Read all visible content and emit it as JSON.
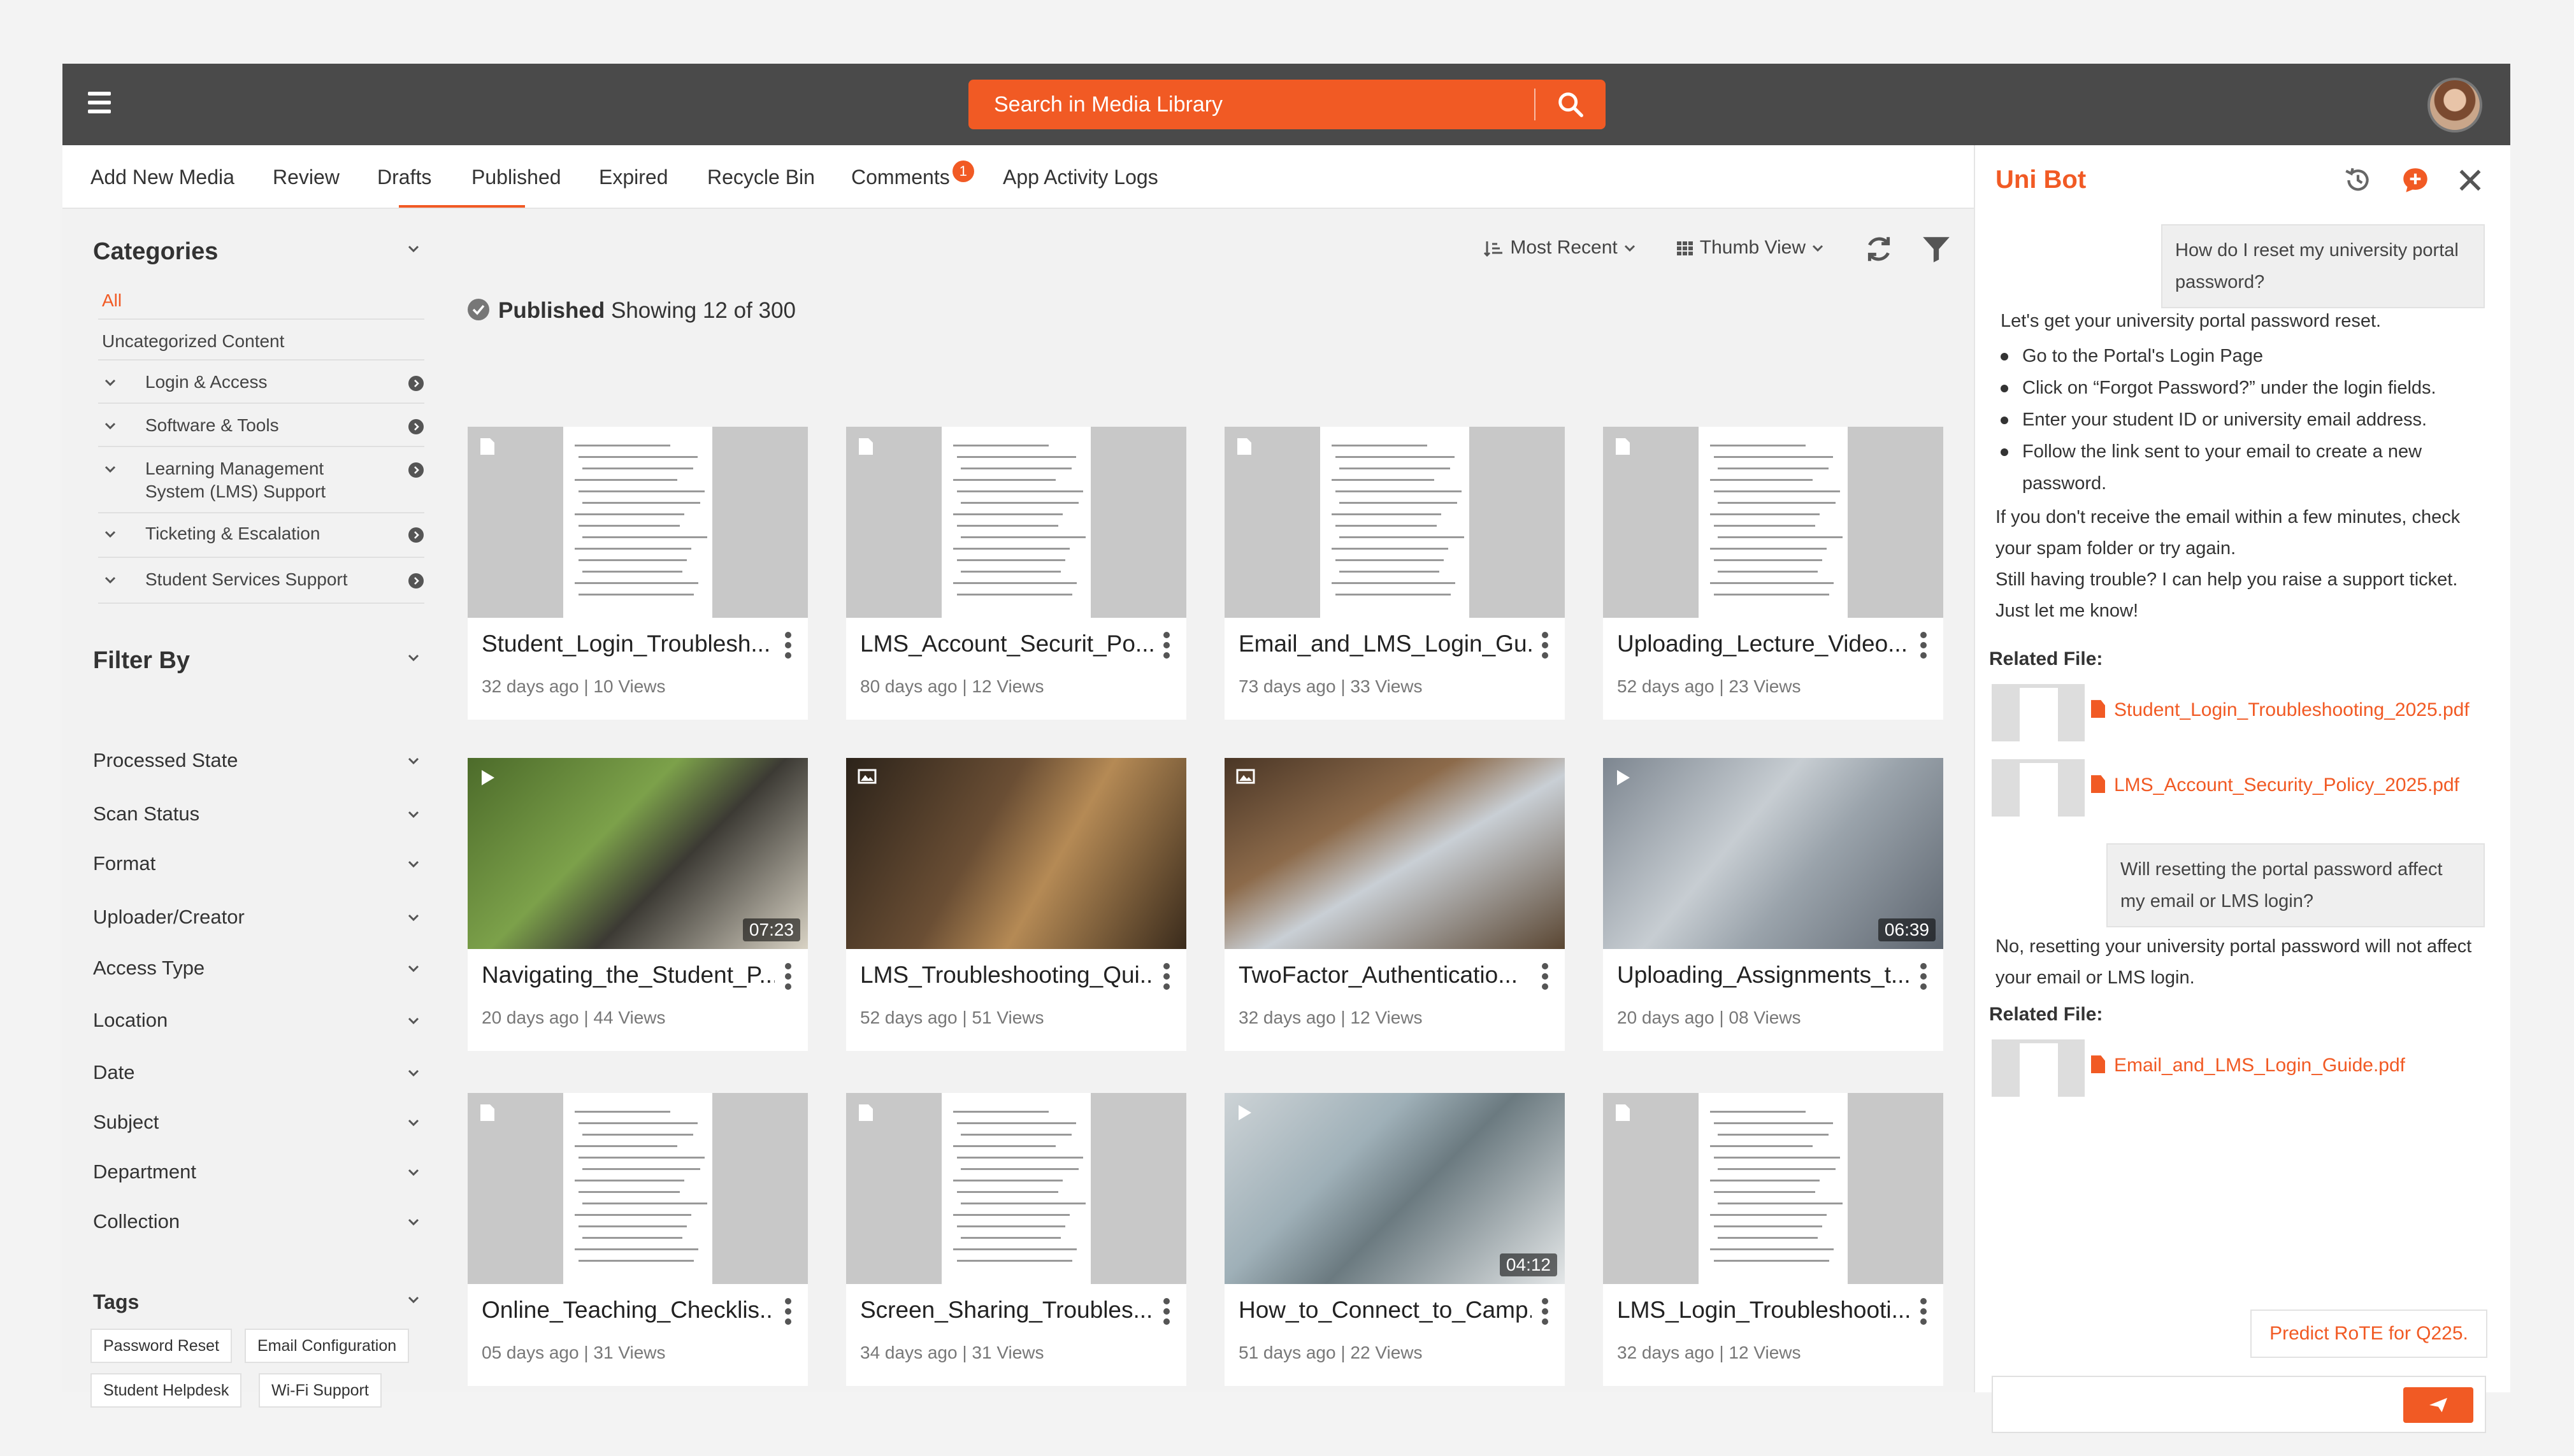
{
  "header": {
    "search_placeholder": "Search in Media Library"
  },
  "nav": {
    "items": [
      "Add New Media",
      "Review",
      "Drafts",
      "Published",
      "Expired",
      "Recycle Bin",
      "Comments",
      "App Activity Logs"
    ],
    "active": "Published",
    "comments_badge": "1"
  },
  "sidebar": {
    "categories_title": "Categories",
    "categories": [
      "All",
      "Uncategorized Content",
      "Login & Access",
      "Software & Tools",
      "Learning Management System (LMS) Support",
      "Ticketing & Escalation",
      "Student Services Support"
    ],
    "filter_title": "Filter By",
    "filters": [
      "Processed State",
      "Scan Status",
      "Format",
      "Uploader/Creator",
      "Access Type",
      "Location",
      "Date",
      "Subject",
      "Department",
      "Collection"
    ],
    "tags_title": "Tags",
    "tags": [
      "Password Reset",
      "Email Configuration",
      "Student Helpdesk",
      "Wi-Fi Support"
    ]
  },
  "toolbar": {
    "sort_label": "Most Recent",
    "view_label": "Thumb View"
  },
  "listing": {
    "section": "Published",
    "showing": "Showing 12 of 300"
  },
  "cards": [
    {
      "title": "Student_Login_Troublesh...",
      "meta": "32 days ago | 10 Views",
      "type": "document"
    },
    {
      "title": "LMS_Account_Securit_Po...",
      "meta": "80 days ago | 12 Views",
      "type": "document"
    },
    {
      "title": "Email_and_LMS_Login_Gu...",
      "meta": "73 days ago | 33 Views",
      "type": "document"
    },
    {
      "title": "Uploading_Lecture_Video...",
      "meta": "52 days ago | 23 Views",
      "type": "document"
    },
    {
      "title": "Navigating_the_Student_P...",
      "meta": "20 days ago | 44 Views",
      "type": "video",
      "duration": "07:23"
    },
    {
      "title": "LMS_Troubleshooting_Qui...",
      "meta": "52 days ago | 51 Views",
      "type": "image"
    },
    {
      "title": "TwoFactor_Authenticatio...",
      "meta": "32 days ago | 12 Views",
      "type": "image"
    },
    {
      "title": "Uploading_Assignments_t...",
      "meta": "20 days ago | 08 Views",
      "type": "video",
      "duration": "06:39"
    },
    {
      "title": "Online_Teaching_Checklis...",
      "meta": "05 days ago | 31 Views",
      "type": "document"
    },
    {
      "title": "Screen_Sharing_Troubles...",
      "meta": "34 days ago | 31 Views",
      "type": "document"
    },
    {
      "title": "How_to_Connect_to_Camp...",
      "meta": "51 days ago | 22 Views",
      "type": "video",
      "duration": "04:12"
    },
    {
      "title": "LMS_Login_Troubleshooti...",
      "meta": "32 days ago | 12 Views",
      "type": "document"
    }
  ],
  "bot": {
    "title": "Uni Bot",
    "q1": "How do I reset my university portal password?",
    "a1_intro": "Let's get your university portal password reset.",
    "a1_steps": [
      "Go to the Portal's Login Page",
      "Click on “Forgot Password?” under the login fields.",
      "Enter your student ID or university email address.",
      "Follow the link sent to your email to create a new password."
    ],
    "a1_outro1": "If you don't receive the email within a few minutes, check your spam folder or try again.",
    "a1_outro2": "Still having trouble? I can help you raise a support ticket. Just let me know!",
    "related_label": "Related File:",
    "related1": [
      "Student_Login_Troubleshooting_2025.pdf",
      "LMS_Account_Security_Policy_2025.pdf"
    ],
    "q2": "Will resetting the portal password affect my email or LMS login?",
    "a2": "No, resetting your university portal password will not affect your email or LMS login.",
    "related2": [
      "Email_and_LMS_Login_Guide.pdf"
    ],
    "suggestion": "Predict RoTE for Q225."
  },
  "colors": {
    "accent": "#f15a24",
    "topbar": "#4a4a4a"
  }
}
